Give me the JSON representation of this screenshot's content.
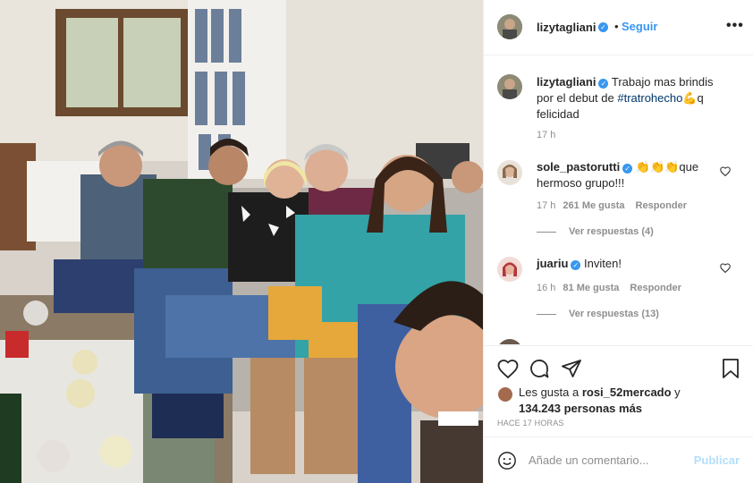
{
  "post": {
    "author": "lizytagliani",
    "follow_label": "Seguir",
    "separator": "•",
    "more_icon": "more-options-icon",
    "more_label": "•••"
  },
  "caption": {
    "username": "lizytagliani",
    "text_before": "Trabajo mas brindis por el debut de ",
    "hashtag": "#tratrohecho",
    "emoji": "💪",
    "text_after": "q felicidad",
    "time": "17 h"
  },
  "comments": [
    {
      "username": "sole_pastorutti",
      "verified": true,
      "emoji": "👏👏👏",
      "text": "que hermoso grupo!!!",
      "time": "17 h",
      "likes": "261 Me gusta",
      "reply_label": "Responder",
      "view_replies": "Ver respuestas (4)"
    },
    {
      "username": "juariu",
      "verified": true,
      "text": "Inviten!",
      "time": "16 h",
      "likes": "81 Me gusta",
      "reply_label": "Responder",
      "view_replies": "Ver respuestas (13)"
    }
  ],
  "likes_summary": {
    "prefix": "Les gusta a ",
    "user": "rosi_52mercado",
    "middle": " y ",
    "count": "134.243 personas más"
  },
  "time_ago": "HACE 17 HORAS",
  "add_comment": {
    "placeholder": "Añade un comentario...",
    "publish_label": "Publicar"
  },
  "colors": {
    "link_blue": "#3897f0",
    "publish_disabled": "#b2dffc",
    "muted": "#8e8e8e",
    "text": "#262626"
  }
}
